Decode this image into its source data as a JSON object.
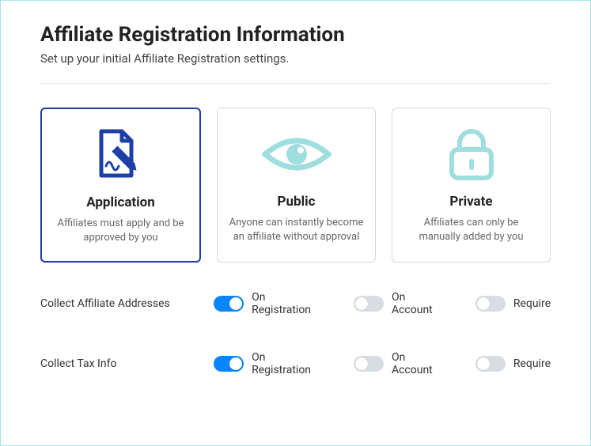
{
  "header": {
    "title": "Affiliate Registration Information",
    "subtitle": "Set up your initial Affiliate Registration settings."
  },
  "modes": {
    "application": {
      "title": "Application",
      "desc": "Affiliates must apply and be approved by you",
      "selected": true
    },
    "public": {
      "title": "Public",
      "desc": "Anyone can instantly become an affiliate without approval",
      "selected": false
    },
    "private": {
      "title": "Private",
      "desc": "Affiliates can only be manually added by you",
      "selected": false
    }
  },
  "settings": {
    "collect_addresses": {
      "label": "Collect Affiliate Addresses",
      "on_registration": {
        "label": "On Registration",
        "value": true
      },
      "on_account": {
        "label": "On Account",
        "value": false
      },
      "require": {
        "label": "Require",
        "value": false
      }
    },
    "collect_tax": {
      "label": "Collect Tax Info",
      "on_registration": {
        "label": "On Registration",
        "value": true
      },
      "on_account": {
        "label": "On Account",
        "value": false
      },
      "require": {
        "label": "Require",
        "value": false
      }
    }
  },
  "colors": {
    "accent_blue": "#1e3fa8",
    "toggle_on": "#0a84ff",
    "icon_teal": "#9fdede"
  }
}
